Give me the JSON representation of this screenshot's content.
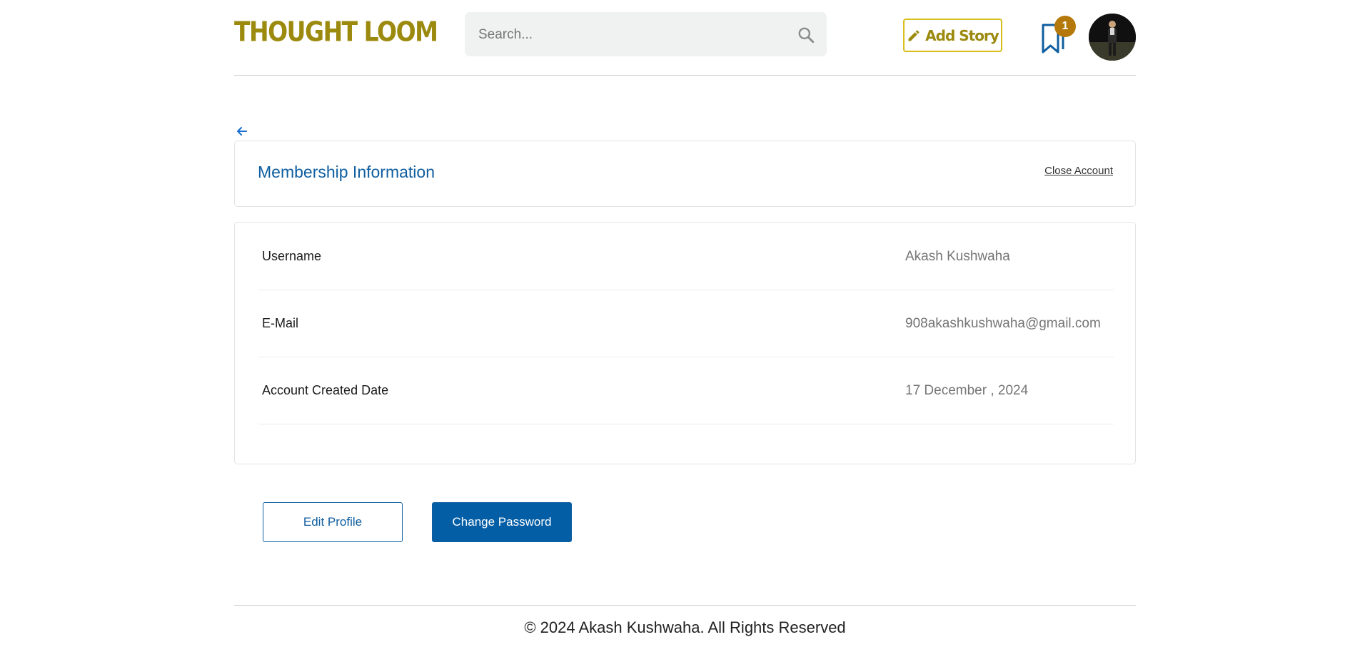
{
  "header": {
    "logo": "THOUGHT LOOM",
    "search": {
      "placeholder": "Search...",
      "value": ""
    },
    "add_story_label": "Add Story",
    "bookmarks_count": "1"
  },
  "membership": {
    "title": "Membership Information",
    "close_account": "Close Account"
  },
  "info": {
    "rows": [
      {
        "label": "Username",
        "value": "Akash Kushwaha"
      },
      {
        "label": "E-Mail",
        "value": "908akashkushwaha@gmail.com"
      },
      {
        "label": "Account Created Date",
        "value": "17 December , 2024"
      }
    ]
  },
  "actions": {
    "edit_profile": "Edit Profile",
    "change_password": "Change Password"
  },
  "footer": {
    "text": "© 2024 Akash Kushwaha. All Rights Reserved"
  },
  "colors": {
    "brand": "#9c8a0e",
    "accent_blue": "#0f5ea0",
    "badge": "#b5780a"
  }
}
